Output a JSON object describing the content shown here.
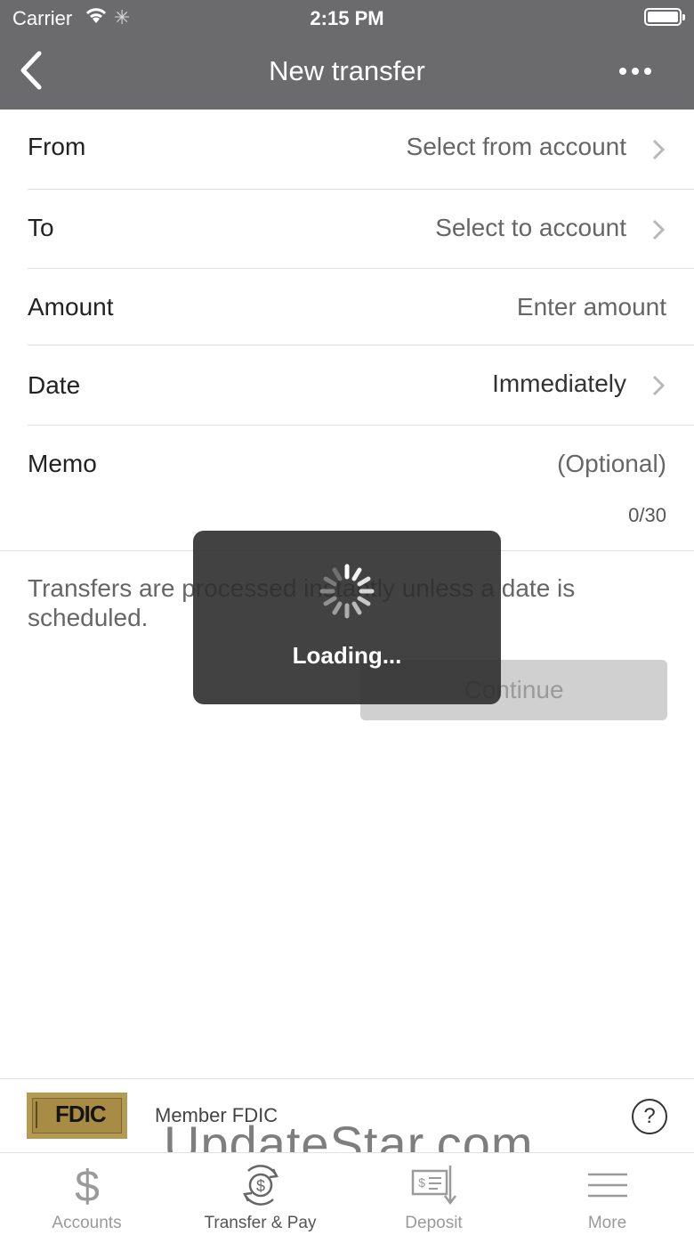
{
  "status_bar": {
    "carrier": "Carrier",
    "time": "2:15 PM"
  },
  "nav": {
    "title": "New transfer"
  },
  "form": {
    "from": {
      "label": "From",
      "value": "Select from account"
    },
    "to": {
      "label": "To",
      "value": "Select to account"
    },
    "amount": {
      "label": "Amount",
      "placeholder": "Enter amount"
    },
    "date": {
      "label": "Date",
      "value": "Immediately"
    },
    "memo": {
      "label": "Memo",
      "placeholder": "(Optional)",
      "count": "0/30"
    }
  },
  "info_text": "Transfers are processed instantly unless a date is scheduled.",
  "continue_label": "Continue",
  "loading": {
    "text": "Loading..."
  },
  "footer": {
    "fdic_logo_text": "FDIC",
    "member_text": "Member FDIC",
    "help_label": "?"
  },
  "watermark": "UpdateStar.com",
  "tabs": [
    {
      "label": "Accounts",
      "icon": "dollar-icon"
    },
    {
      "label": "Transfer & Pay",
      "icon": "transfer-pay-icon"
    },
    {
      "label": "Deposit",
      "icon": "deposit-check-icon"
    },
    {
      "label": "More",
      "icon": "menu-icon"
    }
  ],
  "colors": {
    "header": "#6b6b6d",
    "overlay": "#2d2d2d",
    "disabled_button": "#d0d0d0",
    "fdic_gold": "#b59a53"
  }
}
